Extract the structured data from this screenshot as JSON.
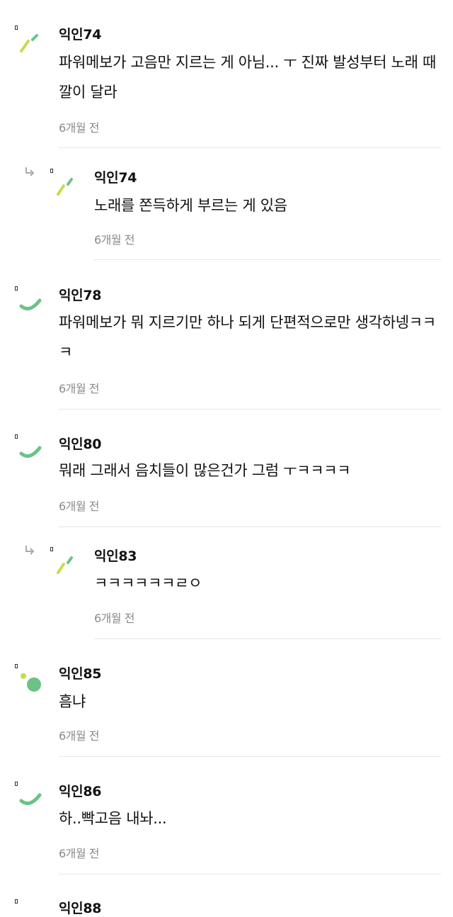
{
  "comments": [
    {
      "author": "익인74",
      "text": "파워메보가 고음만 지르는 게 아님... ㅜ 진짜 발성부터 노래 때깔이 달라",
      "time": "6개월 전",
      "avatar": "sprout-avatar-icon",
      "reply": false
    },
    {
      "author": "익인74",
      "text": "노래를 쫀득하게 부르는 게 있음",
      "time": "6개월 전",
      "avatar": "sprout-avatar-icon",
      "reply": true
    },
    {
      "author": "익인78",
      "text": "파워메보가 뭐 지르기만 하나 되게 단편적으로만 생각하넹ㅋㅋㅋ",
      "time": "6개월 전",
      "avatar": "smile-arc-avatar-icon",
      "reply": false
    },
    {
      "author": "익인80",
      "text": "뭐래 그래서 음치들이 많은건가 그럼 ㅜㅋㅋㅋㅋ",
      "time": "6개월 전",
      "avatar": "smile-arc-avatar-icon",
      "reply": false
    },
    {
      "author": "익인83",
      "text": "ㅋㅋㅋㅋㅋㅋㄹㅇ",
      "time": "6개월 전",
      "avatar": "sprout-avatar-icon",
      "reply": true
    },
    {
      "author": "익인85",
      "text": "흠냐",
      "time": "6개월 전",
      "avatar": "circle-dots-avatar-icon",
      "reply": false
    },
    {
      "author": "익인86",
      "text": "하..빡고음 내놔...",
      "time": "6개월 전",
      "avatar": "smile-arc-avatar-icon",
      "reply": false
    },
    {
      "author": "익인88",
      "text": "",
      "time": "",
      "avatar": "",
      "reply": false
    }
  ],
  "colors": {
    "avatar_green": "#6cc287",
    "avatar_lime": "#c6dd4a",
    "time_gray": "#8a8a8a",
    "divider": "#e6e6e6"
  }
}
